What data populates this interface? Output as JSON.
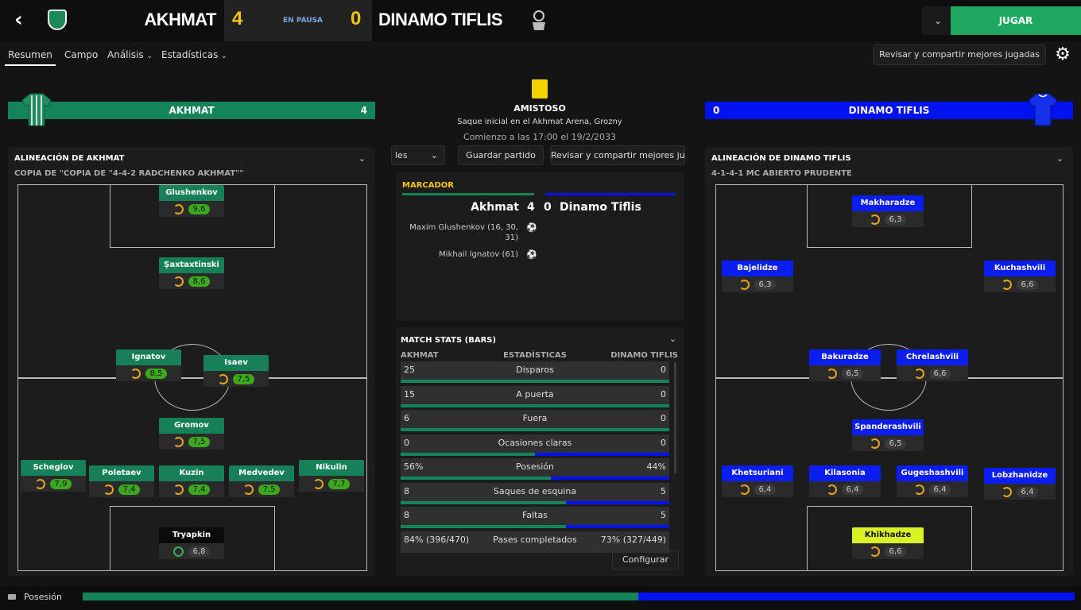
{
  "header": {
    "home_team": "AKHMAT",
    "home_score": "4",
    "status": "EN PAUSA",
    "away_score": "0",
    "away_team": "DINAMO TIFLIS",
    "play_button": "JUGAR"
  },
  "tabs": [
    "Resumen",
    "Campo",
    "Análisis",
    "Estadísticas"
  ],
  "review_button": "Revisar y compartir mejores jugadas",
  "left_team": {
    "name": "AKHMAT",
    "goals": "4",
    "lineup_title": "ALINEACIÓN DE AKHMAT",
    "tactic": "COPIA DE \"COPIA DE \"4-4-2 RADCHENKO AKHMAT\"\""
  },
  "right_team": {
    "name": "DINAMO TIFLIS",
    "goals": "0",
    "lineup_title": "ALINEACIÓN DE DINAMO TIFLIS",
    "tactic": "4-1-4-1 MC ABIERTO PRUDENTE"
  },
  "match_info": {
    "competition": "AMISTOSO",
    "venue": "Saque inicial en el Akhmat Arena, Grozny",
    "start": "Comienzo a las 17:00 el 19/2/2033"
  },
  "center_buttons": {
    "partial": "les",
    "save": "Guardar partido",
    "review": "Revisar y compartir mejores ju"
  },
  "marcador": {
    "title": "MARCADOR",
    "home": "Akhmat",
    "home_score": "4",
    "away_score": "0",
    "away": "Dinamo Tiflis",
    "scorers": [
      "Maxim Glushenkov (16, 30, 31)",
      "Mikhail Ignatov (61)"
    ]
  },
  "stats": {
    "title": "MATCH STATS (BARS)",
    "col_home": "AKHMAT",
    "col_mid": "ESTADÍSTICAS",
    "col_away": "DINAMO TIFLIS",
    "rows": [
      {
        "label": "Disparos",
        "home": "25",
        "away": "0",
        "home_frac": 1.0
      },
      {
        "label": "A puerta",
        "home": "15",
        "away": "0",
        "home_frac": 1.0
      },
      {
        "label": "Fuera",
        "home": "6",
        "away": "0",
        "home_frac": 1.0
      },
      {
        "label": "Ocasiones claras",
        "home": "0",
        "away": "0",
        "home_frac": 0.5
      },
      {
        "label": "Posesión",
        "home": "56%",
        "away": "44%",
        "home_frac": 0.56
      },
      {
        "label": "Saques de esquina",
        "home": "8",
        "away": "5",
        "home_frac": 0.615
      },
      {
        "label": "Faltas",
        "home": "8",
        "away": "5",
        "home_frac": 0.615
      },
      {
        "label": "Pases completados",
        "home": "84% (396/470)",
        "away": "73% (327/449)",
        "home_frac": 0.5
      }
    ],
    "configure": "Configurar"
  },
  "home_players": [
    {
      "name": "Glushenkov",
      "rating": "9,6"
    },
    {
      "name": "Şaxtaxtinski",
      "rating": "8,6"
    },
    {
      "name": "Ignatov",
      "rating": "8,5"
    },
    {
      "name": "Isaev",
      "rating": "7,5"
    },
    {
      "name": "Gromov",
      "rating": "7,5"
    },
    {
      "name": "Scheglov",
      "rating": "7,9"
    },
    {
      "name": "Poletaev",
      "rating": "7,4"
    },
    {
      "name": "Kuzin",
      "rating": "7,4"
    },
    {
      "name": "Medvedev",
      "rating": "7,5"
    },
    {
      "name": "Nikulin",
      "rating": "7,7"
    },
    {
      "name": "Tryapkin",
      "rating": "6,8"
    }
  ],
  "away_players": [
    {
      "name": "Makharadze",
      "rating": "6,3"
    },
    {
      "name": "Bajelidze",
      "rating": "6,3"
    },
    {
      "name": "Kuchashvili",
      "rating": "6,6"
    },
    {
      "name": "Bakuradze",
      "rating": "6,5"
    },
    {
      "name": "Chrelashvili",
      "rating": "6,6"
    },
    {
      "name": "Spanderashvili",
      "rating": "6,5"
    },
    {
      "name": "Khetsuriani",
      "rating": "6,4"
    },
    {
      "name": "Kilasonia",
      "rating": "6,4"
    },
    {
      "name": "Gugeshashvili",
      "rating": "6,4"
    },
    {
      "name": "Lobzhanidze",
      "rating": "6,4"
    },
    {
      "name": "Khikhadze",
      "rating": "6,6"
    }
  ],
  "possession_bar": {
    "label": "Posesión",
    "home_frac": 0.56
  },
  "colors": {
    "home": "#14855a",
    "away": "#0012f0",
    "accent": "#f5c518"
  }
}
